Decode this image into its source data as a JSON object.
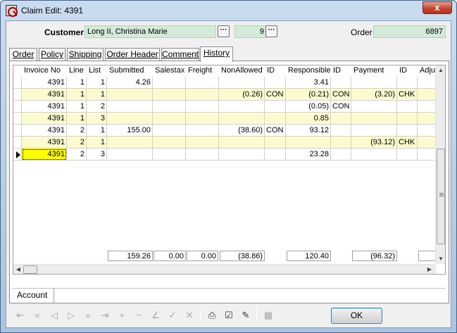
{
  "window": {
    "title": "Claim Edit: 4391",
    "close_glyph": "x"
  },
  "header": {
    "customer_label": "Customer",
    "customer_value": "Long II, Christina Marie",
    "customer_num": "9",
    "ellipsis": "···",
    "order_label": "Order",
    "order_value": "6897"
  },
  "tabs": [
    "Order",
    "Policy",
    "Shipping",
    "Order Header",
    "Comment",
    "History"
  ],
  "active_tab": "History",
  "grid": {
    "columns": [
      "Invoice No",
      "Line",
      "List",
      "Submitted",
      "Salestax",
      "Freight",
      "NonAllowed",
      "ID",
      "Responsible",
      "ID",
      "Payment",
      "ID",
      "Adju"
    ],
    "rows": [
      {
        "highlight": false,
        "cells": [
          "4391",
          "1",
          "1",
          "4.26",
          "",
          "",
          "",
          "",
          "3.41",
          "",
          "",
          "",
          ""
        ]
      },
      {
        "highlight": true,
        "cells": [
          "4391",
          "1",
          "1",
          "",
          "",
          "",
          "(0.26)",
          "CON",
          "(0.21)",
          "CON",
          "(3.20)",
          "CHK",
          ""
        ]
      },
      {
        "highlight": false,
        "cells": [
          "4391",
          "1",
          "2",
          "",
          "",
          "",
          "",
          "",
          "(0.05)",
          "CON",
          "",
          "",
          ""
        ]
      },
      {
        "highlight": true,
        "cells": [
          "4391",
          "1",
          "3",
          "",
          "",
          "",
          "",
          "",
          "0.85",
          "",
          "",
          "",
          ""
        ]
      },
      {
        "highlight": false,
        "cells": [
          "4391",
          "2",
          "1",
          "155.00",
          "",
          "",
          "(38.60)",
          "CON",
          "93.12",
          "",
          "",
          "",
          ""
        ]
      },
      {
        "highlight": true,
        "cells": [
          "4391",
          "2",
          "1",
          "",
          "",
          "",
          "",
          "",
          "",
          "",
          "(93.12)",
          "CHK",
          ""
        ]
      },
      {
        "highlight": false,
        "cells": [
          "4391",
          "2",
          "3",
          "",
          "",
          "",
          "",
          "",
          "23.28",
          "",
          "",
          "",
          ""
        ]
      }
    ],
    "totals": {
      "submitted": "159.26",
      "salestax": "0.00",
      "freight": "0.00",
      "nonallowed": "(38.86)",
      "responsible": "120.40",
      "payment": "(96.32)"
    }
  },
  "account_label": "Account",
  "ok_label": "OK",
  "toolbar_icons": [
    "first-icon",
    "prior-page-icon",
    "prior-icon",
    "next-icon",
    "next-page-icon",
    "last-icon",
    "insert-icon",
    "delete-icon",
    "edit-icon",
    "post-icon",
    "cancel-icon",
    "print-icon",
    "checklist-icon",
    "pen-icon",
    "calculator-icon"
  ],
  "colors": {
    "field_bg": "#d3ead8",
    "row_highlight": "#fbfbcf",
    "selected_cell": "#ffff00"
  }
}
